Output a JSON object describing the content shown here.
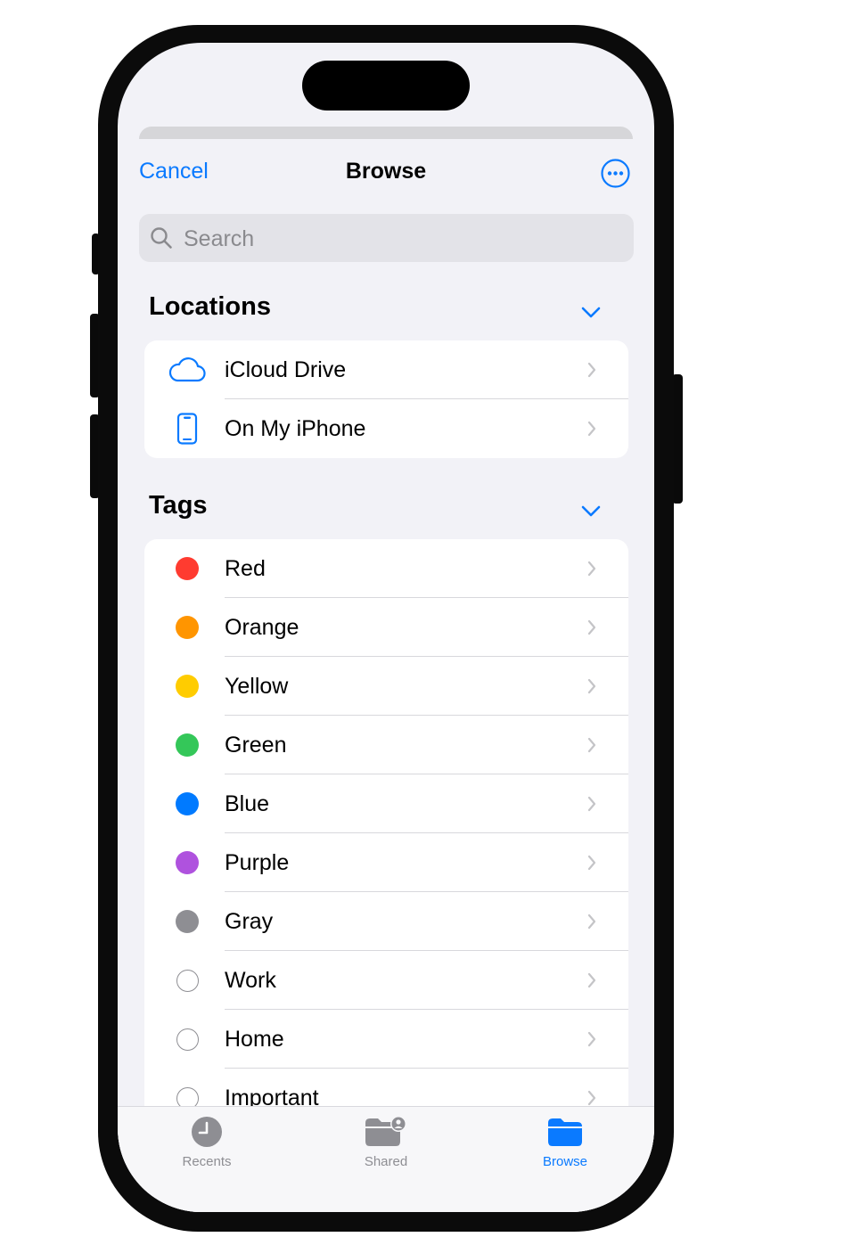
{
  "nav": {
    "cancel_label": "Cancel",
    "title": "Browse"
  },
  "search": {
    "placeholder": "Search"
  },
  "locations": {
    "header": "Locations",
    "items": [
      {
        "label": "iCloud Drive",
        "icon": "cloud-icon"
      },
      {
        "label": "On My iPhone",
        "icon": "iphone-icon"
      }
    ]
  },
  "tags": {
    "header": "Tags",
    "items": [
      {
        "label": "Red",
        "color": "#ff3b30"
      },
      {
        "label": "Orange",
        "color": "#ff9500"
      },
      {
        "label": "Yellow",
        "color": "#ffcc00"
      },
      {
        "label": "Green",
        "color": "#34c759"
      },
      {
        "label": "Blue",
        "color": "#007aff"
      },
      {
        "label": "Purple",
        "color": "#af52de"
      },
      {
        "label": "Gray",
        "color": "#8e8e93"
      },
      {
        "label": "Work",
        "color": "none"
      },
      {
        "label": "Home",
        "color": "none"
      },
      {
        "label": "Important",
        "color": "none"
      }
    ]
  },
  "tabbar": {
    "tabs": [
      {
        "label": "Recents",
        "icon": "clock-icon",
        "active": false
      },
      {
        "label": "Shared",
        "icon": "shared-folder-icon",
        "active": false
      },
      {
        "label": "Browse",
        "icon": "folder-icon",
        "active": true
      }
    ]
  },
  "colors": {
    "accent": "#0a7aff",
    "background": "#f2f2f7"
  }
}
